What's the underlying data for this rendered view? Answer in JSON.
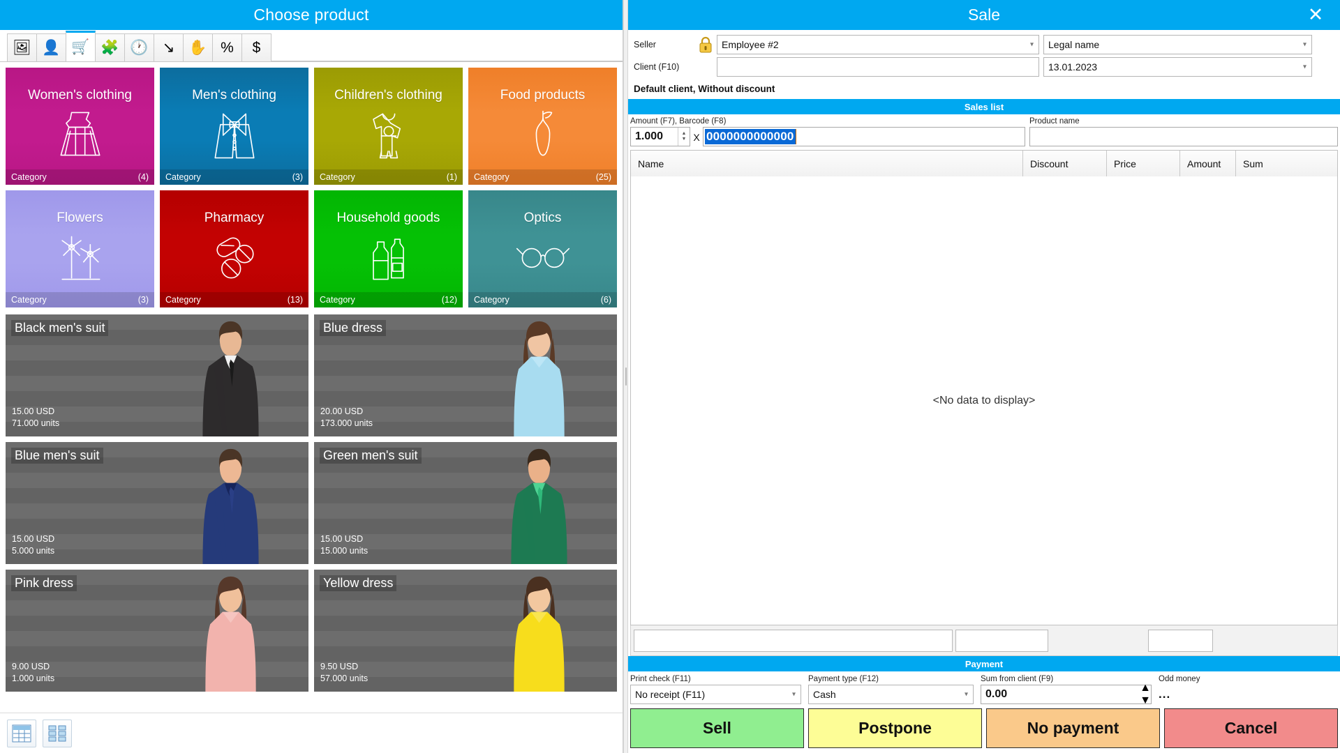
{
  "left": {
    "title": "Choose product",
    "tabs": [
      {
        "name": "picture-tab",
        "icon": "picture-icon",
        "glyph": "🖼",
        "active": false
      },
      {
        "name": "person-tab",
        "icon": "person-icon",
        "glyph": "👤",
        "active": false
      },
      {
        "name": "cart-tab",
        "icon": "shopping-cart-icon",
        "glyph": "🛒",
        "active": true
      },
      {
        "name": "puzzle-tab",
        "icon": "puzzle-icon",
        "glyph": "🧩",
        "active": false
      },
      {
        "name": "clock-tab",
        "icon": "clock-icon",
        "glyph": "🕐",
        "active": false
      },
      {
        "name": "arrow-tab",
        "icon": "curved-arrow-down-icon",
        "glyph": "↘",
        "active": false
      },
      {
        "name": "hand-tab",
        "icon": "hand-icon",
        "glyph": "✋",
        "active": false
      },
      {
        "name": "percent-tab",
        "icon": "percent-icon",
        "glyph": "%",
        "active": false
      },
      {
        "name": "coin-tab",
        "icon": "dollar-coin-icon",
        "glyph": "$",
        "active": false
      }
    ],
    "category_caption": "Category",
    "categories": [
      {
        "label": "Women's clothing",
        "count": "(4)",
        "color": "#c21b8e",
        "color2": "#b81785",
        "art": "dress"
      },
      {
        "label": "Men's clothing",
        "count": "(3)",
        "color": "#0a7cb5",
        "color2": "#0c6d9e",
        "art": "tuxedo"
      },
      {
        "label": "Children's clothing",
        "count": "(1)",
        "color": "#a8a805",
        "color2": "#9b9b04",
        "art": "romper"
      },
      {
        "label": "Food products",
        "count": "(25)",
        "color": "#f58a38",
        "color2": "#ef7f29",
        "art": "pear"
      },
      {
        "label": "Flowers",
        "count": "(3)",
        "color": "#a9a3ee",
        "color2": "#9f98ea",
        "art": "flowers"
      },
      {
        "label": "Pharmacy",
        "count": "(13)",
        "color": "#c30202",
        "color2": "#b40000",
        "art": "pills"
      },
      {
        "label": "Household goods",
        "count": "(12)",
        "color": "#05c105",
        "color2": "#03b503",
        "art": "bottles"
      },
      {
        "label": "Optics",
        "count": "(6)",
        "color": "#3f9295",
        "color2": "#38878a",
        "art": "glasses"
      }
    ],
    "products": [
      {
        "name": "Black men's suit",
        "price": "15.00 USD",
        "units": "71.000 units",
        "art": "man-black-suit"
      },
      {
        "name": "Blue dress",
        "price": "20.00 USD",
        "units": "173.000 units",
        "art": "woman-blue-dress"
      },
      {
        "name": "Blue men's suit",
        "price": "15.00 USD",
        "units": "5.000 units",
        "art": "man-blue-suit"
      },
      {
        "name": "Green men's suit",
        "price": "15.00 USD",
        "units": "15.000 units",
        "art": "man-green-suit"
      },
      {
        "name": "Pink dress",
        "price": "9.00 USD",
        "units": "1.000 units",
        "art": "woman-pink-dress"
      },
      {
        "name": "Yellow dress",
        "price": "9.50 USD",
        "units": "57.000 units",
        "art": "woman-yellow-dress"
      }
    ],
    "view_buttons": [
      {
        "name": "table-view-button",
        "icon": "table-view-icon"
      },
      {
        "name": "tile-view-button",
        "icon": "tile-view-icon"
      }
    ]
  },
  "right": {
    "title": "Sale",
    "close_label": "✕",
    "seller_label": "Seller",
    "seller_value": "Employee #2",
    "legal_name_value": "Legal name",
    "client_label": "Client (F10)",
    "client_value": "",
    "date_value": "13.01.2023",
    "client_note": "Default client, Without discount",
    "sales_list_title": "Sales list",
    "amount_label": "Amount (F7), Barcode (F8)",
    "amount_value": "1.000",
    "multiply_symbol": "X",
    "barcode_value": "0000000000000",
    "product_name_label": "Product name",
    "product_name_value": "",
    "table": {
      "columns": [
        "Name",
        "Discount",
        "Price",
        "Amount",
        "Sum"
      ],
      "rows": [],
      "empty_text": "<No data to display>"
    },
    "payment": {
      "section_title": "Payment",
      "print_check_label": "Print check (F11)",
      "print_check_value": "No receipt (F11)",
      "payment_type_label": "Payment type (F12)",
      "payment_type_value": "Cash",
      "sum_from_client_label": "Sum from client (F9)",
      "sum_from_client_value": "0.00",
      "odd_money_label": "Odd money",
      "odd_money_value": "...",
      "buttons": [
        {
          "label": "Sell",
          "name": "sell-button",
          "color": "#90ee90"
        },
        {
          "label": "Postpone",
          "name": "postpone-button",
          "color": "#fdfd96"
        },
        {
          "label": "No payment",
          "name": "no-payment-button",
          "color": "#fac98a"
        },
        {
          "label": "Cancel",
          "name": "cancel-button",
          "color": "#f28b8b"
        }
      ]
    }
  },
  "colors": {
    "accent": "#00a8f0",
    "selection": "#0a69d6",
    "card_bg": "#6d6d6d"
  }
}
